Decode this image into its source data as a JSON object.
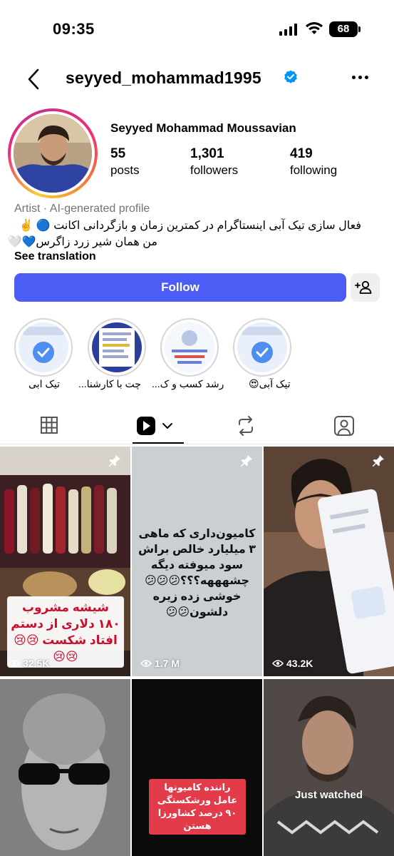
{
  "status_bar": {
    "time": "09:35",
    "battery": "68"
  },
  "header": {
    "username": "seyyed_mohammad1995"
  },
  "profile": {
    "full_name": "Seyyed Mohammad Moussavian",
    "posts_count": "55",
    "posts_label": "posts",
    "followers_count": "1,301",
    "followers_label": "followers",
    "following_count": "419",
    "following_label": "following",
    "category": "Artist · AI-generated profile",
    "bio_line1": "فعال سازی تیک آبی اینستاگرام در کمترین زمان و بازگردانی اکانت 🔵 ✌️",
    "bio_line2": "من همان شیر زرد زاگرس💙🤍",
    "see_translation": "See translation"
  },
  "actions": {
    "follow": "Follow"
  },
  "highlights": [
    {
      "label": "تیک ابی"
    },
    {
      "label": "چت با کارشنا..."
    },
    {
      "label": "رشد کسب و ک..."
    },
    {
      "label": "تیک آبی😍"
    }
  ],
  "posts": [
    {
      "overlay_text": "شیشه مشروب ۱۸۰ دلاری از دستم افتاد شکست 😢😢😢😢",
      "views": "32.5K",
      "pinned": true
    },
    {
      "overlay_text": "کامیون‌داری که ماهی ۳ میلیارد خالص براش سود میوفته دیگه چشهههه؟؟؟😕😕😕 خوشی زده زیره دلشون😕😕",
      "views": "1.7 M",
      "pinned": true
    },
    {
      "views": "43.2K",
      "pinned": true
    },
    {
      "overlay_text": ""
    },
    {
      "overlay_text": "راننده کامیونها عامل ورشکستگی ۹۰ درصد کشاورزا هستن"
    },
    {
      "overlay_text": "Just watched"
    }
  ],
  "colors": {
    "follow_blue": "#4c5df6",
    "verified_blue": "#0095f6",
    "muted_gray": "#737373"
  }
}
